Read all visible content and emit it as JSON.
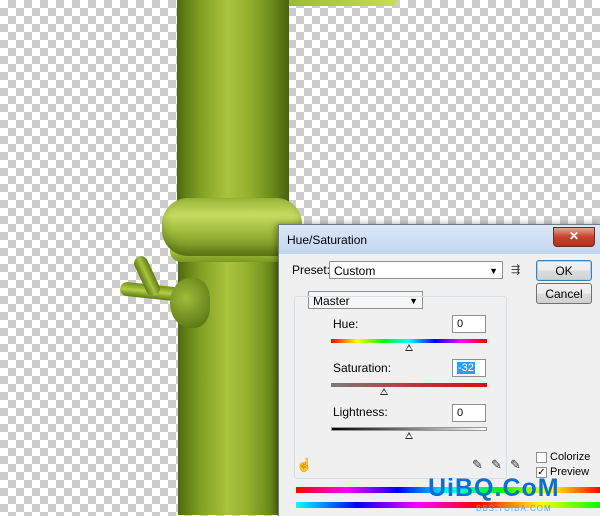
{
  "dialog": {
    "title": "Hue/Saturation",
    "close_label": "✕",
    "preset_label": "Preset:",
    "preset_value": "Custom",
    "preset_menu_icon": "preset-options-icon",
    "channel_value": "Master",
    "hue": {
      "label": "Hue:",
      "value": "0",
      "level": 0.5
    },
    "saturation": {
      "label": "Saturation:",
      "value": "-32",
      "level": 0.34
    },
    "lightness": {
      "label": "Lightness:",
      "value": "0",
      "level": 0.5
    },
    "ok_label": "OK",
    "cancel_label": "Cancel",
    "colorize": {
      "label": "Colorize",
      "checked": false
    },
    "preview": {
      "label": "Preview",
      "checked": true,
      "mark": "✓"
    }
  },
  "watermark": {
    "main": "UiBQ.CoM",
    "sub": "BBS.TUIBA.COM"
  },
  "colors": {
    "titlebar": "#c3d6ef",
    "close_button": "#c7422c",
    "dialog_bg": "#f0f0f0",
    "bamboo": "#8fb02d",
    "watermark": "#0a6fcf"
  }
}
